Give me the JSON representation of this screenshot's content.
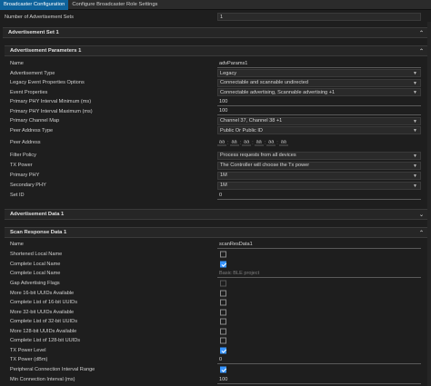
{
  "tabs": [
    "Broadcaster Configuration",
    "Configure Broadcaster Role Settings"
  ],
  "top": {
    "label": "Number of Advertisement Sets",
    "value": "1"
  },
  "adv_set": {
    "title": "Advertisement Set 1"
  },
  "adv_params": {
    "title": "Advertisement Parameters 1",
    "name": {
      "label": "Name",
      "value": "advParams1"
    },
    "adv_type": {
      "label": "Advertisement Type",
      "value": "Legacy"
    },
    "legacy_opts": {
      "label": "Legacy Event Properties Options",
      "value": "Connectable and scannable undirected"
    },
    "event_props": {
      "label": "Event Properties",
      "value": "Connectable advertising, Scannable advertising +1"
    },
    "int_min": {
      "label": "Primary PHY Interval Minimum (ms)",
      "value": "100"
    },
    "int_max": {
      "label": "Primary PHY Interval Maximum (ms)",
      "value": "100"
    },
    "channel_map": {
      "label": "Primary Channel Map",
      "value": "Channel 37, Channel 38 +1"
    },
    "peer_addr_type": {
      "label": "Peer Address Type",
      "value": "Public Or Public ID"
    },
    "peer_addr": {
      "label": "Peer Address",
      "octets": [
        "aa",
        "aa",
        "aa",
        "aa",
        "aa",
        "aa"
      ],
      "sep": ":"
    },
    "filter_policy": {
      "label": "Filter Policy",
      "value": "Process requests from all devices"
    },
    "tx_power": {
      "label": "TX Power",
      "value": "The Controller will choose the Tx power"
    },
    "primary_phy": {
      "label": "Primary PHY",
      "value": "1M"
    },
    "secondary_phy": {
      "label": "Secondary PHY",
      "value": "1M"
    },
    "set_id": {
      "label": "Set ID",
      "value": "0"
    }
  },
  "adv_data": {
    "title": "Advertisement Data 1"
  },
  "scan_resp": {
    "title": "Scan Response Data 1",
    "name": {
      "label": "Name",
      "value": "scanResData1"
    },
    "shortened_local_name": {
      "label": "Shortened Local Name"
    },
    "complete_local_name": {
      "label": "Complete Local Name"
    },
    "complete_local_name_text": {
      "label": "Complete Local Name",
      "placeholder": "Basic BLE project"
    },
    "gap_flags": {
      "label": "Gap Advertising Flags"
    },
    "more16": {
      "label": "More 16-bit UUIDs Available"
    },
    "complete16": {
      "label": "Complete List of 16-bit UUIDs"
    },
    "more32": {
      "label": "More 32-bit UUIDs Available"
    },
    "complete32": {
      "label": "Complete List of 32-bit UUIDs"
    },
    "more128": {
      "label": "More 128-bit UUIDs Available"
    },
    "complete128": {
      "label": "Complete List of 128-bit UUIDs"
    },
    "tx_power_level": {
      "label": "TX Power Level"
    },
    "tx_power_dbm": {
      "label": "TX Power (dBm)",
      "value": "0"
    },
    "periph_conn_int": {
      "label": "Peripheral Connection Interval Range"
    },
    "min_conn_int": {
      "label": "Min Connection Interval (ms)",
      "value": "100"
    }
  },
  "icons": {
    "chevron": "chevron-down-icon",
    "collapse": "caret-up-icon",
    "expand": "caret-down-icon",
    "checkbox": "checkbox-icon"
  },
  "colors": {
    "accent": "#0e639c",
    "checkbox_checked": "#3794ff",
    "background": "#1e1e1e"
  }
}
